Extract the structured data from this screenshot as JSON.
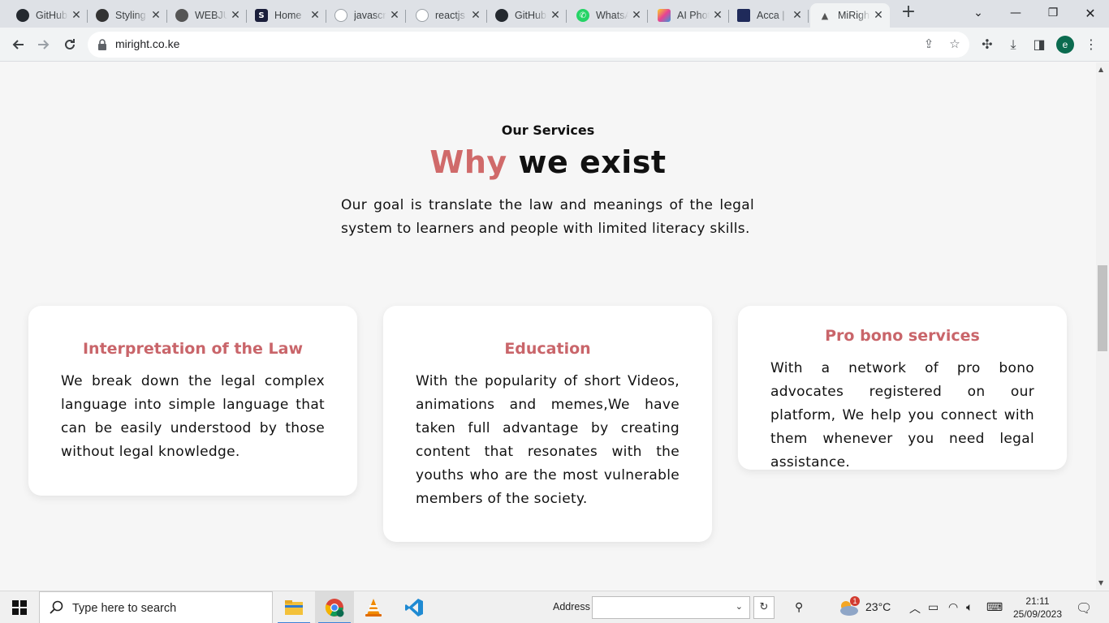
{
  "browser": {
    "tabs": [
      {
        "title": "GitHub",
        "icon": "github-icon",
        "color": "#24292f",
        "glyph": "●"
      },
      {
        "title": "Styling",
        "icon": "styling-icon",
        "color": "#333333",
        "glyph": "◎"
      },
      {
        "title": "WEBJU",
        "icon": "github-icon",
        "color": "#555555",
        "glyph": "◯"
      },
      {
        "title": "Home",
        "icon": "s-logo-icon",
        "color": "#1b1f3b",
        "glyph": "S"
      },
      {
        "title": "javascr",
        "icon": "generic-site-icon",
        "color": "#9aa0a6",
        "glyph": "◌"
      },
      {
        "title": "reactjs",
        "icon": "generic-site-icon",
        "color": "#9aa0a6",
        "glyph": "◌"
      },
      {
        "title": "GitHub",
        "icon": "github-icon",
        "color": "#24292f",
        "glyph": "●"
      },
      {
        "title": "WhatsApp",
        "icon": "whatsapp-icon",
        "color": "#25d366",
        "glyph": "✆"
      },
      {
        "title": "AI Photo",
        "icon": "ai-photo-icon",
        "color": "#e84393",
        "glyph": "■"
      },
      {
        "title": "Acca |",
        "icon": "acca-icon",
        "color": "#1f2a5a",
        "glyph": "▦"
      },
      {
        "title": "MiRight",
        "icon": "miright-icon",
        "color": "#ffffff",
        "glyph": "▲"
      }
    ],
    "active_tab_index": 10,
    "url": "miright.co.ke"
  },
  "page": {
    "kicker": "Our Services",
    "title_accent": "Why",
    "title_rest": " we exist",
    "intro": "Our goal is translate the law and meanings of the legal system to learners and people with limited literacy skills.",
    "accent_color": "#d06a6a",
    "cards": [
      {
        "title": "Interpretation of the Law",
        "body": "We break down the legal complex language into simple language that can be easily understood by those without legal knowledge."
      },
      {
        "title": "Education",
        "body": "With the popularity of short Videos, animations and memes,We have taken full advantage by creating content that resonates with the youths who are the most vulnerable members of the society."
      },
      {
        "title": "Pro bono services",
        "body": "With a network of pro bono advocates registered on our platform, We help you connect with them whenever you need legal assistance."
      }
    ]
  },
  "taskbar": {
    "search_placeholder": "Type here to search",
    "address_label": "Address",
    "weather": "23°C",
    "weather_badge": "1",
    "time": "21:11",
    "date": "25/09/2023"
  }
}
